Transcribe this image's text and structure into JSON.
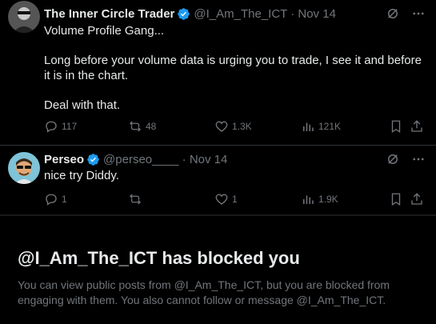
{
  "tweets": [
    {
      "author_name": "The Inner Circle Trader",
      "handle_date": "@I_Am_The_ICT · Nov 14",
      "text_lines": [
        "Volume Profile Gang...",
        "Long before your volume data is urging you to trade, I see it and before it is in the chart.",
        "Deal with that."
      ],
      "actions": {
        "replies": "117",
        "reposts": "48",
        "likes": "1.3K",
        "views": "121K"
      }
    },
    {
      "author_name": "Perseo",
      "handle_date": "@perseo____ · Nov 14",
      "text": "nice try Diddy.",
      "actions": {
        "replies": "1",
        "reposts": "",
        "likes": "1",
        "views": "1.9K"
      }
    }
  ],
  "blocked_notice": {
    "title": "@I_Am_The_ICT has blocked you",
    "body": "You can view public posts from @I_Am_The_ICT, but you are blocked from engaging with them. You also cannot follow or message @I_Am_The_ICT."
  },
  "colors": {
    "background": "#000000",
    "text_primary": "#e7e9ea",
    "text_secondary": "#71767b",
    "verified_blue": "#1d9bf0",
    "divider": "#2f3336"
  },
  "icons": [
    "verified-badge-icon",
    "grok-icon",
    "more-icon",
    "reply-icon",
    "repost-icon",
    "like-icon",
    "views-icon",
    "bookmark-icon",
    "share-icon"
  ]
}
